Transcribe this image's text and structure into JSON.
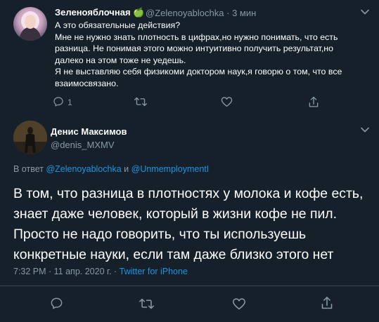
{
  "parent_tweet": {
    "display_name": "Зеленояблочная",
    "emoji": "🍏",
    "handle": "@Zelenoyablochka",
    "separator": "·",
    "time": "3 мин",
    "lines": [
      "А это обязательные действия?",
      "Мне не нужно знать плотность в цифрах,но нужно понимать, что есть разница. Не понимая этого можно интуитивно получить результат,но далеко на этом тоже не уедешь.",
      "Я не выставляю себя физикоми доктором наук,я говорю о том, что все взаимосвязано."
    ],
    "reply_count": "1"
  },
  "main_tweet": {
    "display_name": "Денис Максимов",
    "handle": "@denis_MXMV",
    "reply_prefix": "В ответ",
    "reply_user_1": "@Zelenoyablochka",
    "reply_conj": "и",
    "reply_user_2": "@UnmemploymentI",
    "text": "В том, что разница в плотностях у молока и кофе есть, знает даже человек, который в жизни кофе не пил. Просто не надо говорить, что ты используешь конкретные науки, если там даже близко этого нет",
    "timestamp": "7:32 PM · 11 апр. 2020 г. · ",
    "source": "Twitter for iPhone"
  },
  "colors": {
    "background": "#15202b",
    "muted": "#8899a6",
    "link": "#1b95e0",
    "divider": "#38444d"
  }
}
